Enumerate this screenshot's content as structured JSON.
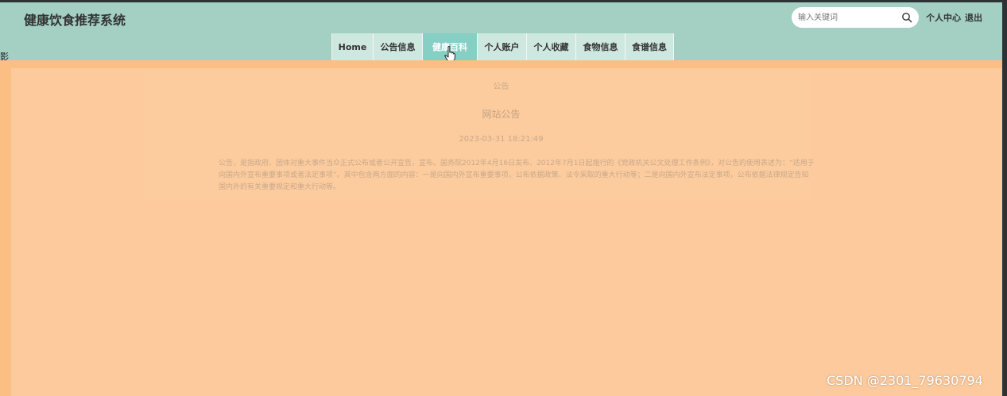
{
  "header": {
    "site_title": "健康饮食推荐系统",
    "search": {
      "placeholder": "输入关键词",
      "value": ""
    },
    "user_center": "个人中心",
    "logout": "退出"
  },
  "nav": {
    "items": [
      {
        "label": "Home",
        "active": false
      },
      {
        "label": "公告信息",
        "active": false
      },
      {
        "label": "健康百科",
        "active": true
      },
      {
        "label": "个人账户",
        "active": false
      },
      {
        "label": "个人收藏",
        "active": false
      },
      {
        "label": "食物信息",
        "active": false
      },
      {
        "label": "食谱信息",
        "active": false
      }
    ]
  },
  "side_glyph": "影",
  "content": {
    "breadcrumb": "公告",
    "title": "网站公告",
    "date": "2023-03-31 18:21:49",
    "body": "公告，是指政府、团体对重大事件当众正式公布或者公开宣告，宣布。国务院2012年4月16日发布、2012年7月1日起施行的《党政机关公文处理工作条例》，对公告的使用表述为：“适用于向国内外宣布重要事项或者法定事项”。其中包含两方面的内容：一是向国内外宣布重要事项，公布依据政策、法令采取的重大行动等；二是向国内外宣布法定事项，公布依据法律规定告知国内外的有关重要规定和重大行动等。"
  },
  "watermark": "CSDN @2301_79630794",
  "colors": {
    "header_bg": "#a3d0c2",
    "nav_item_bg": "#cfe8df",
    "nav_active_bg": "#86cfc4",
    "page_bg": "#fcca9c",
    "band": "#fbbf83"
  },
  "icons": {
    "search": "search-icon",
    "cursor": "pointer-cursor-icon"
  }
}
